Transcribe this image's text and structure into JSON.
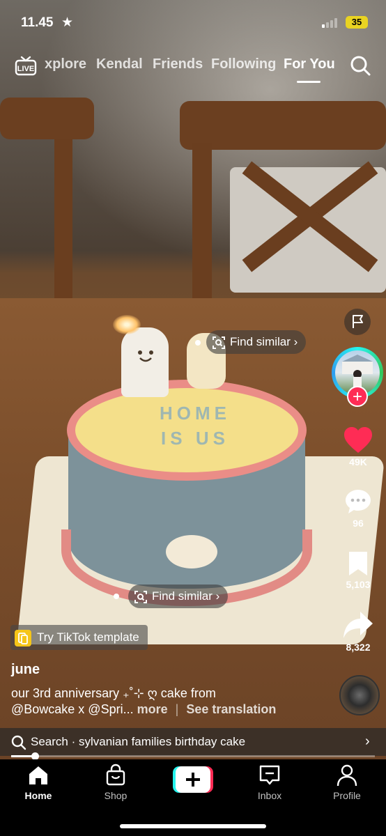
{
  "status_bar": {
    "time": "11.45",
    "battery": "35"
  },
  "top_nav": {
    "tabs": [
      {
        "label": "xplore"
      },
      {
        "label": "Kendal"
      },
      {
        "label": "Friends"
      },
      {
        "label": "Following"
      },
      {
        "label": "For You"
      }
    ],
    "active_tab": "For You",
    "live_icon_label": "LIVE"
  },
  "video": {
    "find_similar_1": "Find similar",
    "find_similar_2": "Find similar",
    "cake_text_line1": "HOME",
    "cake_text_line2": "IS US"
  },
  "right_rail": {
    "likes": "49K",
    "comments": "96",
    "bookmarks": "5,103",
    "shares": "8,322"
  },
  "post": {
    "template_label": "Try TikTok template",
    "username": "june",
    "caption_line1": "our 3rd anniversary ₊˚⊹ ღ  cake from",
    "caption_line2": "@Bowcake x @Spri...",
    "more_label": "more",
    "see_translation_label": "See translation"
  },
  "search_suggestion": {
    "text": "Search · sylvanian families birthday cake"
  },
  "playback": {
    "progress_fraction": 0.065
  },
  "bottom_nav": {
    "items": [
      {
        "label": "Home"
      },
      {
        "label": "Shop"
      },
      {
        "label": "Inbox"
      },
      {
        "label": "Profile"
      }
    ]
  },
  "colors": {
    "accent": "#fe2c55",
    "like": "#fe2c55",
    "battery": "#e9d322"
  }
}
